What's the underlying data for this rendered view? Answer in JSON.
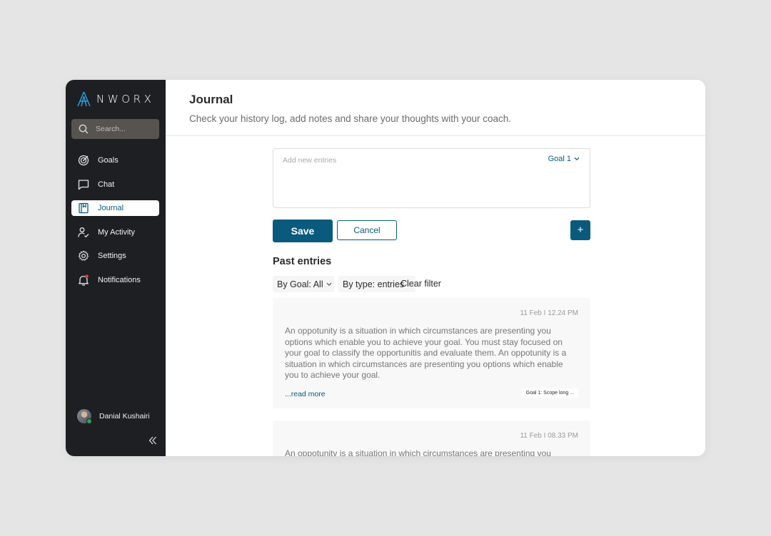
{
  "app": {
    "brand": "NWORX",
    "colors": {
      "accent": "#0a5a7d",
      "sidebar": "#1e1f22",
      "active_bg": "#ffffff"
    }
  },
  "sidebar": {
    "search_placeholder": "Search...",
    "items": [
      {
        "label": "Goals",
        "icon": "target-icon"
      },
      {
        "label": "Chat",
        "icon": "chat-icon"
      },
      {
        "label": "Journal",
        "icon": "journal-icon",
        "active": true
      },
      {
        "label": "My Activity",
        "icon": "activity-icon"
      },
      {
        "label": "Settings",
        "icon": "gear-icon"
      },
      {
        "label": "Notifications",
        "icon": "bell-icon"
      }
    ],
    "user": {
      "name": "Danial Kushairi",
      "status": "online"
    }
  },
  "header": {
    "title": "Journal",
    "subtitle": "Check your history log, add notes and share your thoughts with your coach."
  },
  "composer": {
    "placeholder": "Add new entries",
    "goal_selected": "Goal 1",
    "save_label": "Save",
    "cancel_label": "Cancel",
    "add_label": "+"
  },
  "past": {
    "title": "Past entries",
    "filter_goal": "By Goal: All",
    "filter_type": "By type: entries",
    "clear_filter": "Clear filter",
    "entries": [
      {
        "date": "11 Feb I 12.24 PM",
        "text": "An oppotunity is a situation in which circumstances are presenting you options which enable you to achieve your goal. You must stay focused on your goal to classify the opportunitis and evaluate them. An oppotunity is a situation in which circumstances are presenting you options which enable you to achieve your goal.",
        "read_more": "...read more",
        "tag": "Goal 1: Scope long ..."
      },
      {
        "date": "11 Feb I 08.33 PM",
        "text": "An oppotunity is a situation in which circumstances are presenting you"
      }
    ]
  }
}
